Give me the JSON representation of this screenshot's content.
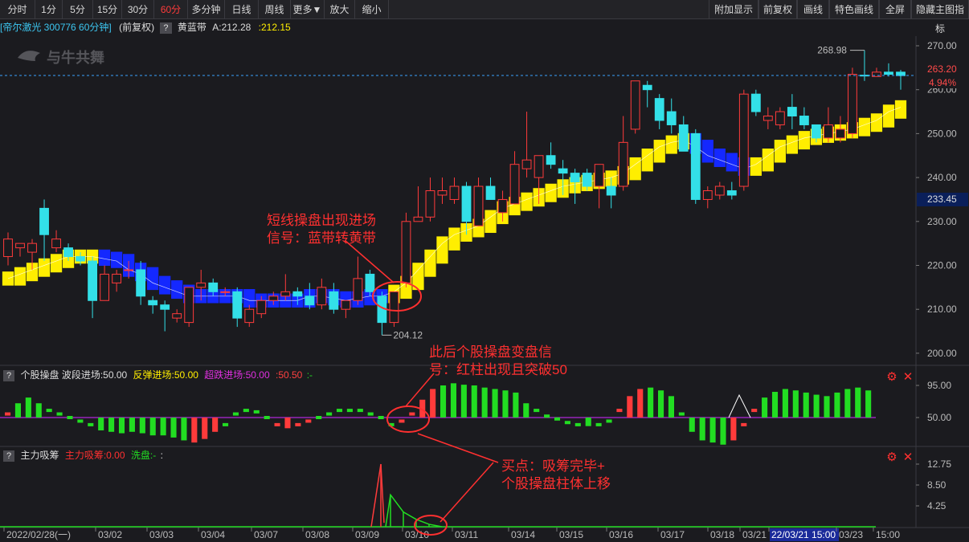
{
  "toolbar": {
    "left": [
      "分时",
      "1分",
      "5分",
      "15分",
      "30分",
      "60分",
      "多分钟",
      "日线",
      "周线",
      "更多▼",
      "放大",
      "缩小"
    ],
    "active": "60分",
    "right": [
      "附加显示",
      "前复权",
      "画线",
      "特色画线",
      "全屏",
      "隐藏主图指标"
    ]
  },
  "header": {
    "stock": "[帝尔激光 300776 60分钟]",
    "adjust": "(前复权)",
    "q": "?",
    "indicator": "黄蓝带",
    "a_label": "A:212.28",
    "a_value": ":212.15"
  },
  "watermark": "与牛共舞",
  "main_axis": {
    "ticks": [
      "270.00",
      "260.00",
      "250.00",
      "240.00",
      "230.00",
      "220.00",
      "210.00",
      "200.00"
    ],
    "current_price": "263.20",
    "change_pct": "4.94%",
    "cursor_price": "233.45",
    "high_label": "268.98",
    "low_label": "204.12"
  },
  "panel2": {
    "q": "?",
    "name": "个股操盘",
    "items": [
      "波段进场:50.00",
      "反弹进场:50.00",
      "超跌进场:50.00",
      ":50.50",
      ":-"
    ],
    "ticks": [
      "95.00",
      "50.00"
    ]
  },
  "panel3": {
    "q": "?",
    "name": "主力吸筹",
    "items": [
      "主力吸筹:0.00",
      "洗盘:-",
      ":"
    ],
    "ticks": [
      "12.75",
      "8.50",
      "4.25"
    ]
  },
  "dates": [
    "2022/02/28(一)",
    "03/02",
    "03/03",
    "03/04",
    "03/07",
    "03/08",
    "03/09",
    "03/10",
    "03/11",
    "03/14",
    "03/15",
    "03/16",
    "03/17",
    "03/18",
    "03/21",
    "22/03/21 15:00",
    "03/23",
    "15:00"
  ],
  "annotations": {
    "a1_line1": "短线操盘出现进场",
    "a1_line2": "信号：蓝带转黄带",
    "a2_line1": "此后个股操盘变盘信",
    "a2_line2": "号：红柱出现且突破50",
    "a3_line1": "买点：吸筹完毕+",
    "a3_line2": "个股操盘柱体上移"
  },
  "colors": {
    "up": "#ff3b3b",
    "down": "#33e0e8",
    "band_up": "#ffee00",
    "band_down": "#1428ff",
    "green": "#22dd22",
    "purple": "#b026d6",
    "note": "#ff3030"
  },
  "chart_data": {
    "type": "candlestick",
    "candles": [
      {
        "o": 222,
        "h": 227.5,
        "l": 220,
        "c": 226
      },
      {
        "o": 224,
        "h": 225,
        "l": 222,
        "c": 225
      },
      {
        "o": 223,
        "h": 226,
        "l": 219,
        "c": 225
      },
      {
        "o": 233,
        "h": 235,
        "l": 221,
        "c": 227
      },
      {
        "o": 224,
        "h": 228,
        "l": 223,
        "c": 226
      },
      {
        "o": 224,
        "h": 225,
        "l": 221,
        "c": 222
      },
      {
        "o": 222,
        "h": 223,
        "l": 220,
        "c": 221
      },
      {
        "o": 221,
        "h": 222,
        "l": 208,
        "c": 212
      },
      {
        "o": 212,
        "h": 220,
        "l": 212,
        "c": 218
      },
      {
        "o": 216,
        "h": 219,
        "l": 214,
        "c": 218
      },
      {
        "o": 219,
        "h": 221,
        "l": 217,
        "c": 219
      },
      {
        "o": 219,
        "h": 221,
        "l": 211,
        "c": 213
      },
      {
        "o": 212,
        "h": 213,
        "l": 209,
        "c": 211
      },
      {
        "o": 211,
        "h": 212,
        "l": 205,
        "c": 210
      },
      {
        "o": 208,
        "h": 210,
        "l": 207,
        "c": 209
      },
      {
        "o": 207,
        "h": 215,
        "l": 206,
        "c": 215
      },
      {
        "o": 215,
        "h": 219,
        "l": 212,
        "c": 216
      },
      {
        "o": 216,
        "h": 217,
        "l": 213,
        "c": 214
      },
      {
        "o": 214,
        "h": 215,
        "l": 213,
        "c": 214
      },
      {
        "o": 214,
        "h": 215,
        "l": 206,
        "c": 208
      },
      {
        "o": 207,
        "h": 211,
        "l": 206,
        "c": 210
      },
      {
        "o": 209,
        "h": 213,
        "l": 208,
        "c": 212
      },
      {
        "o": 212,
        "h": 214,
        "l": 211,
        "c": 213
      },
      {
        "o": 213,
        "h": 218,
        "l": 212,
        "c": 214
      },
      {
        "o": 214,
        "h": 215,
        "l": 211,
        "c": 213
      },
      {
        "o": 213,
        "h": 216,
        "l": 210,
        "c": 211
      },
      {
        "o": 211,
        "h": 217,
        "l": 210,
        "c": 215
      },
      {
        "o": 214,
        "h": 216,
        "l": 209,
        "c": 210
      },
      {
        "o": 210,
        "h": 212,
        "l": 208,
        "c": 212
      },
      {
        "o": 212,
        "h": 222,
        "l": 211,
        "c": 217
      },
      {
        "o": 218,
        "h": 219,
        "l": 213,
        "c": 214
      },
      {
        "o": 213,
        "h": 214,
        "l": 204.12,
        "c": 207
      },
      {
        "o": 207,
        "h": 214,
        "l": 206,
        "c": 214
      },
      {
        "o": 216,
        "h": 232,
        "l": 215,
        "c": 230
      },
      {
        "o": 230,
        "h": 238,
        "l": 230,
        "c": 231
      },
      {
        "o": 231,
        "h": 240,
        "l": 230,
        "c": 237
      },
      {
        "o": 236,
        "h": 240,
        "l": 234,
        "c": 237
      },
      {
        "o": 235,
        "h": 240,
        "l": 234,
        "c": 238
      },
      {
        "o": 238,
        "h": 239,
        "l": 227,
        "c": 230
      },
      {
        "o": 229,
        "h": 240,
        "l": 229,
        "c": 238
      },
      {
        "o": 238,
        "h": 240,
        "l": 235,
        "c": 235
      },
      {
        "o": 232,
        "h": 237,
        "l": 230,
        "c": 235
      },
      {
        "o": 234,
        "h": 246,
        "l": 234,
        "c": 243
      },
      {
        "o": 242,
        "h": 255,
        "l": 240,
        "c": 244
      },
      {
        "o": 240,
        "h": 245,
        "l": 234,
        "c": 245
      },
      {
        "o": 245,
        "h": 248,
        "l": 242,
        "c": 243
      },
      {
        "o": 242,
        "h": 244,
        "l": 236,
        "c": 241
      },
      {
        "o": 241,
        "h": 242,
        "l": 234,
        "c": 239
      },
      {
        "o": 241,
        "h": 242,
        "l": 237,
        "c": 238
      },
      {
        "o": 238,
        "h": 243,
        "l": 233,
        "c": 243
      },
      {
        "o": 238,
        "h": 240,
        "l": 233,
        "c": 236
      },
      {
        "o": 238,
        "h": 254,
        "l": 237,
        "c": 248
      },
      {
        "o": 251,
        "h": 262,
        "l": 250,
        "c": 262
      },
      {
        "o": 261,
        "h": 262,
        "l": 256,
        "c": 260
      },
      {
        "o": 258,
        "h": 259,
        "l": 251,
        "c": 253
      },
      {
        "o": 255,
        "h": 258,
        "l": 250,
        "c": 252
      },
      {
        "o": 252,
        "h": 254,
        "l": 246,
        "c": 246
      },
      {
        "o": 250,
        "h": 251,
        "l": 234,
        "c": 235
      },
      {
        "o": 235,
        "h": 238,
        "l": 233,
        "c": 237
      },
      {
        "o": 236,
        "h": 239,
        "l": 235,
        "c": 238
      },
      {
        "o": 237,
        "h": 239,
        "l": 235,
        "c": 236
      },
      {
        "o": 238,
        "h": 260,
        "l": 237,
        "c": 259
      },
      {
        "o": 259,
        "h": 260,
        "l": 254,
        "c": 255
      },
      {
        "o": 253,
        "h": 256,
        "l": 251,
        "c": 254
      },
      {
        "o": 252,
        "h": 256,
        "l": 251,
        "c": 255
      },
      {
        "o": 256,
        "h": 259,
        "l": 251,
        "c": 254
      },
      {
        "o": 254,
        "h": 256,
        "l": 251,
        "c": 252
      },
      {
        "o": 252,
        "h": 252,
        "l": 248,
        "c": 249
      },
      {
        "o": 249,
        "h": 256,
        "l": 248,
        "c": 252
      },
      {
        "o": 249,
        "h": 254,
        "l": 248,
        "c": 251
      },
      {
        "o": 250,
        "h": 265,
        "l": 249,
        "c": 263.5
      },
      {
        "o": 263.3,
        "h": 268.98,
        "l": 262,
        "c": 263.2
      },
      {
        "o": 263,
        "h": 265,
        "l": 263,
        "c": 264
      },
      {
        "o": 264,
        "h": 266,
        "l": 263,
        "c": 263.5
      },
      {
        "o": 264,
        "h": 264.5,
        "l": 260,
        "c": 263.2
      }
    ],
    "band": [
      217,
      218,
      219,
      220,
      221,
      222,
      222,
      222,
      221.5,
      221,
      219,
      218,
      216,
      215,
      214,
      213,
      213,
      213,
      213,
      213,
      212,
      212,
      212,
      212,
      212,
      213,
      213,
      212.5,
      212,
      212.5,
      213,
      213,
      214,
      216,
      219,
      222,
      225,
      227,
      228,
      229,
      231,
      233,
      234,
      235,
      236,
      237,
      238,
      238.5,
      239,
      239.5,
      240,
      241,
      243,
      245,
      247,
      248,
      248.5,
      247,
      245,
      244,
      243,
      242,
      243,
      245,
      247,
      248,
      249,
      249.5,
      250,
      250.5,
      251,
      252,
      253,
      255,
      256
    ],
    "band_dir": [
      "u",
      "u",
      "u",
      "u",
      "u",
      "u",
      "u",
      "u",
      "d",
      "d",
      "d",
      "d",
      "d",
      "d",
      "d",
      "d",
      "d",
      "d",
      "d",
      "d",
      "d",
      "d",
      "d",
      "d",
      "d",
      "d",
      "d",
      "d",
      "d",
      "d",
      "d",
      "d",
      "u",
      "u",
      "u",
      "u",
      "u",
      "u",
      "u",
      "u",
      "u",
      "u",
      "u",
      "u",
      "u",
      "u",
      "u",
      "u",
      "u",
      "u",
      "u",
      "u",
      "u",
      "u",
      "u",
      "u",
      "u",
      "d",
      "d",
      "d",
      "d",
      "d",
      "u",
      "u",
      "u",
      "u",
      "u",
      "u",
      "u",
      "u",
      "u",
      "u",
      "u",
      "u",
      "u"
    ],
    "osc": [
      55,
      70,
      78,
      70,
      60,
      55,
      50,
      45,
      40,
      32,
      30,
      28,
      30,
      28,
      25,
      25,
      22,
      18,
      15,
      20,
      30,
      40,
      55,
      60,
      58,
      50,
      40,
      35,
      40,
      45,
      50,
      55,
      60,
      60,
      60,
      55,
      50,
      40,
      45,
      55,
      75,
      90,
      95,
      98,
      96,
      95,
      92,
      90,
      88,
      85,
      70,
      60,
      52,
      48,
      43,
      40,
      38,
      40,
      45,
      60,
      80,
      90,
      92,
      88,
      80,
      55,
      30,
      18,
      15,
      12,
      18,
      40,
      60,
      78,
      86,
      90,
      88,
      85,
      82,
      80,
      85,
      90,
      92,
      88
    ],
    "osc_color": [
      "r",
      "g",
      "g",
      "g",
      "g",
      "g",
      "g",
      "g",
      "g",
      "g",
      "g",
      "g",
      "g",
      "g",
      "g",
      "g",
      "g",
      "g",
      "r",
      "r",
      "r",
      "g",
      "g",
      "g",
      "g",
      "g",
      "r",
      "r",
      "r",
      "r",
      "g",
      "g",
      "g",
      "g",
      "g",
      "g",
      "g",
      "g",
      "r",
      "r",
      "r",
      "r",
      "g",
      "g",
      "g",
      "g",
      "g",
      "g",
      "g",
      "g",
      "g",
      "g",
      "g",
      "g",
      "g",
      "g",
      "g",
      "g",
      "g",
      "r",
      "r",
      "r",
      "g",
      "g",
      "g",
      "g",
      "g",
      "g",
      "g",
      "g",
      "r",
      "r",
      "r",
      "g",
      "g",
      "g",
      "g",
      "g",
      "g",
      "g",
      "g",
      "g",
      "g",
      "g"
    ],
    "accum_spike": [
      12.75,
      0.8
    ],
    "accum_green": [
      6.5,
      3.0,
      1.5,
      0.5
    ]
  }
}
